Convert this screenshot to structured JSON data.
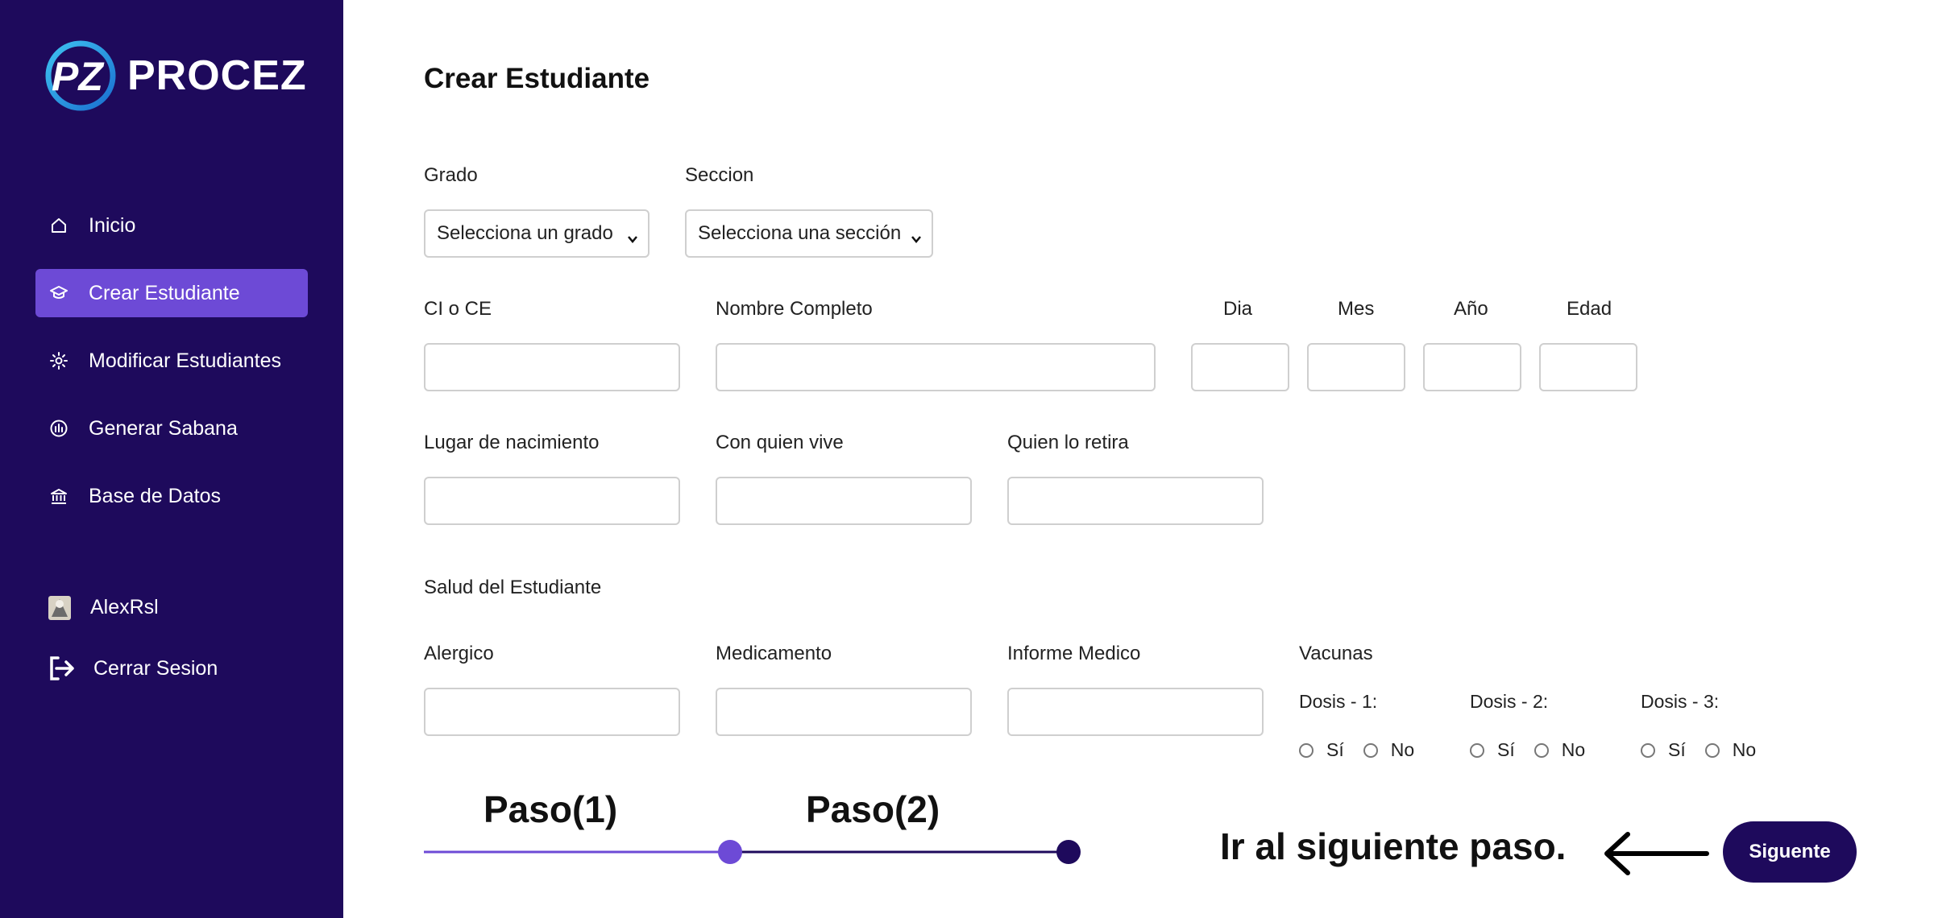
{
  "app": {
    "name": "PROCEZ",
    "logo_mark": "PZ"
  },
  "sidebar": {
    "items": [
      {
        "label": "Inicio",
        "icon": "home-icon",
        "active": false
      },
      {
        "label": "Crear Estudiante",
        "icon": "graduation-cap-icon",
        "active": true
      },
      {
        "label": "Modificar Estudiantes",
        "icon": "gear-icon",
        "active": false
      },
      {
        "label": "Generar Sabana",
        "icon": "building-icon",
        "active": false
      },
      {
        "label": "Base de Datos",
        "icon": "bank-icon",
        "active": false
      }
    ],
    "user": {
      "name": "AlexRsl"
    },
    "logout_label": "Cerrar Sesion"
  },
  "form": {
    "title": "Crear Estudiante",
    "grado": {
      "label": "Grado",
      "value": "Selecciona un grado"
    },
    "seccion": {
      "label": "Seccion",
      "value": "Selecciona una sección"
    },
    "ci": {
      "label": "CI o CE",
      "value": ""
    },
    "nombre": {
      "label": "Nombre Completo",
      "value": ""
    },
    "dia": {
      "label": "Dia",
      "value": ""
    },
    "mes": {
      "label": "Mes",
      "value": ""
    },
    "anio": {
      "label": "Año",
      "value": ""
    },
    "edad": {
      "label": "Edad",
      "value": ""
    },
    "lugar": {
      "label": "Lugar de nacimiento",
      "value": ""
    },
    "vive": {
      "label": "Con quien vive",
      "value": ""
    },
    "retira": {
      "label": "Quien lo retira",
      "value": ""
    },
    "salud_title": "Salud del Estudiante",
    "alergico": {
      "label": "Alergico",
      "value": ""
    },
    "medicamento": {
      "label": "Medicamento",
      "value": ""
    },
    "informe": {
      "label": "Informe Medico",
      "value": ""
    },
    "vacunas": {
      "label": "Vacunas",
      "doses": [
        {
          "label": "Dosis - 1:",
          "yes": "Sí",
          "no": "No"
        },
        {
          "label": "Dosis - 2:",
          "yes": "Sí",
          "no": "No"
        },
        {
          "label": "Dosis - 3:",
          "yes": "Sí",
          "no": "No"
        }
      ]
    }
  },
  "stepper": {
    "steps": [
      "Paso(1)",
      "Paso(2)"
    ],
    "active_color": "#6d4ad6",
    "inactive_color": "#1e0a5c"
  },
  "hint": "Ir al siguiente paso.",
  "next_button": "Siguente",
  "colors": {
    "sidebar_bg": "#1e0a5c",
    "accent": "#6d4ad6"
  }
}
